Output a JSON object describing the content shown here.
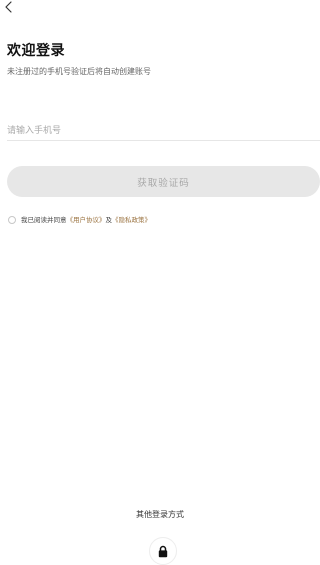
{
  "navigation": {
    "back_icon": "back-chevron-icon"
  },
  "header": {
    "title": "欢迎登录",
    "subtitle": "未注册过的手机号验证后将自动创建账号"
  },
  "form": {
    "phone_placeholder": "请输入手机号",
    "phone_value": "",
    "get_code_label": "获取验证码"
  },
  "agreement": {
    "checked": false,
    "prefix": "我已阅读并同意",
    "user_agreement": "《用户协议》",
    "joiner": "及",
    "privacy_policy": "《隐私政策》"
  },
  "footer": {
    "other_login_label": "其他登录方式",
    "lock_icon": "lock-icon"
  },
  "colors": {
    "background": "#ffffff",
    "button_disabled": "#e7e7e7",
    "button_text_disabled": "#a8a8a8",
    "link": "#9b7340"
  }
}
